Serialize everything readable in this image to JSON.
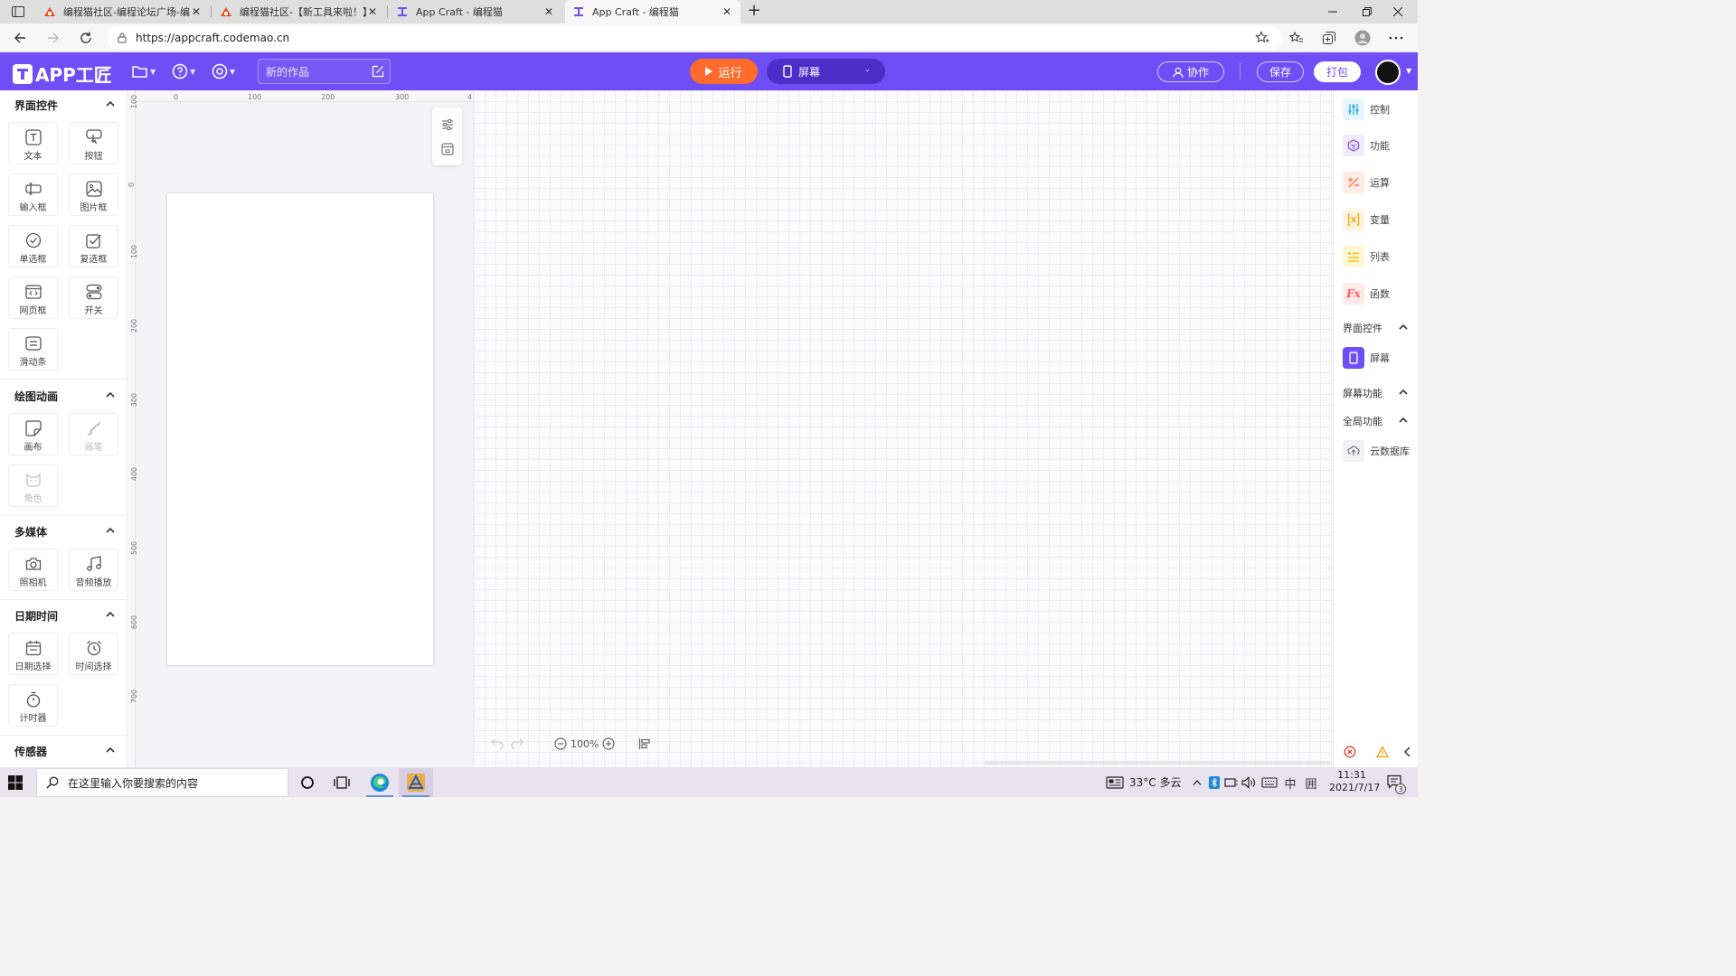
{
  "browser": {
    "tabs": [
      {
        "title": "编程猫社区-编程论坛广场-编程学"
      },
      {
        "title": "编程猫社区-【新工具来啦！】AI"
      },
      {
        "title": "App Craft - 编程猫"
      },
      {
        "title": "App Craft - 编程猫",
        "active": true
      }
    ],
    "url": "https://appcraft.codemao.cn"
  },
  "app": {
    "logo_text": "APP工匠",
    "project_name": "新的作品",
    "run_label": "运行",
    "screen_label": "屏幕",
    "collab_label": "协作",
    "save_label": "保存",
    "pack_label": "打包",
    "accent_color": "#6f4ef5",
    "run_color": "#ff6b2c"
  },
  "left_panel": {
    "sections": [
      {
        "title": "界面控件",
        "items": [
          "文本",
          "按钮",
          "输入框",
          "图片框",
          "单选框",
          "复选框",
          "网页框",
          "开关",
          "滑动条"
        ]
      },
      {
        "title": "绘图动画",
        "items": [
          "画布",
          "画笔",
          "角色"
        ]
      },
      {
        "title": "多媒体",
        "items": [
          "照相机",
          "音频播放"
        ]
      },
      {
        "title": "日期时间",
        "items": [
          "日期选择",
          "时间选择",
          "计时器"
        ]
      },
      {
        "title": "传感器",
        "items": []
      }
    ]
  },
  "rulers": {
    "h_ticks": [
      "0",
      "100",
      "200",
      "300",
      "4"
    ],
    "v_ticks": [
      "100",
      "0",
      "100",
      "200",
      "300",
      "400",
      "500",
      "600",
      "700"
    ]
  },
  "zoom": {
    "level": "100%"
  },
  "right_panel": {
    "tools": [
      "控制",
      "功能",
      "运算",
      "变量",
      "列表",
      "函数"
    ],
    "ui_section": "界面控件",
    "screen_item": "屏幕",
    "screen_func_section": "屏幕功能",
    "global_section": "全局功能",
    "cloud_item": "云数据库",
    "fx_label": "Fx"
  },
  "taskbar": {
    "search_placeholder": "在这里输入你要搜索的内容",
    "weather": "33°C 多云",
    "ime_lang": "中",
    "ime_mode": "囲",
    "time": "11:31",
    "date": "2021/7/17",
    "notification_count": "3"
  }
}
